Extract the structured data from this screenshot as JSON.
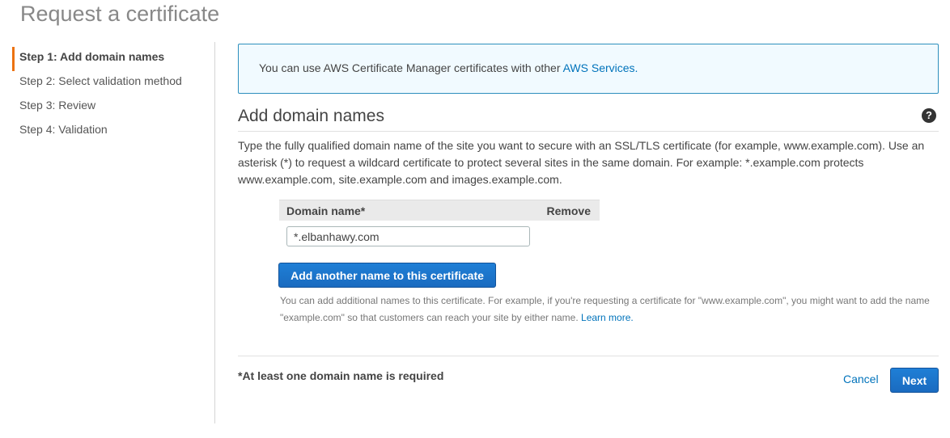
{
  "page": {
    "title": "Request a certificate"
  },
  "steps": [
    {
      "label": "Step 1: Add domain names",
      "active": true
    },
    {
      "label": "Step 2: Select validation method",
      "active": false
    },
    {
      "label": "Step 3: Review",
      "active": false
    },
    {
      "label": "Step 4: Validation",
      "active": false
    }
  ],
  "info": {
    "text": "You can use AWS Certificate Manager certificates with other ",
    "link": "AWS Services."
  },
  "section": {
    "title": "Add domain names",
    "help_icon": "?",
    "description": "Type the fully qualified domain name of the site you want to secure with an SSL/TLS certificate (for example, www.example.com). Use an asterisk (*) to request a wildcard certificate to protect several sites in the same domain. For example: *.example.com protects www.example.com, site.example.com and images.example.com."
  },
  "table": {
    "col_domain": "Domain name*",
    "col_remove": "Remove",
    "domain_value": "*.elbanhawy.com"
  },
  "add_button": {
    "label": "Add another name to this certificate"
  },
  "hint": {
    "text": "You can add additional names to this certificate. For example, if you're requesting a certificate for \"www.example.com\", you might want to add the name \"example.com\" so that customers can reach your site by either name. ",
    "link": "Learn more."
  },
  "footer": {
    "required_note": "*At least one domain name is required",
    "cancel_label": "Cancel",
    "next_label": "Next"
  },
  "colors": {
    "accent": "#ec7211",
    "primary_button": "#1a6bc0",
    "link": "#0073bb",
    "info_border": "#2d8fbd",
    "info_bg": "#f1faff"
  }
}
